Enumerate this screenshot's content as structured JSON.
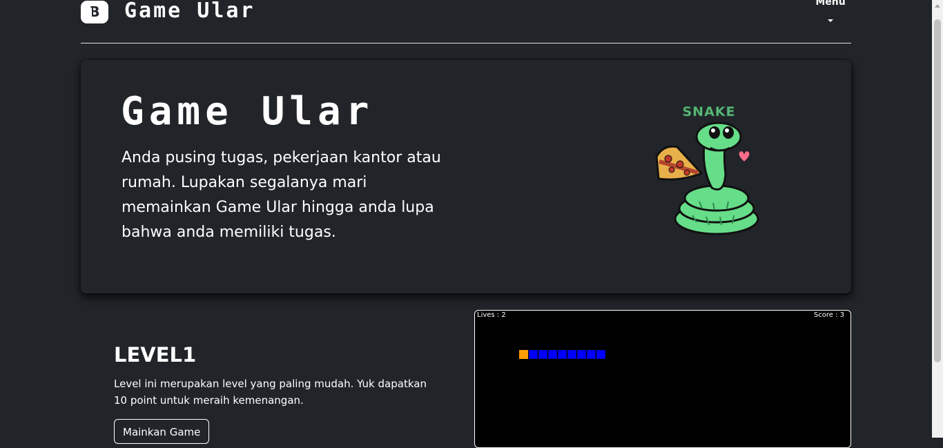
{
  "header": {
    "logo_letter": "B",
    "brand": "Game Ular",
    "menu_label": "Menu"
  },
  "hero": {
    "title": "Game Ular",
    "text": "Anda pusing tugas, pekerjaan kantor atau rumah. Lupakan segalanya mari memainkan Game Ular hingga anda lupa bahwa anda memiliki tugas.",
    "image_caption": "SNAKE"
  },
  "level": {
    "title": "LEVEL1",
    "description": "Level ini merupakan level yang paling mudah. Yuk dapatkan 10 point untuk meraih kemenangan.",
    "button_label": "Mainkan Game"
  },
  "game": {
    "lives_text": "Lives : 2",
    "score_text": "Score : 3",
    "snake": {
      "head_color": "#ff9e00",
      "body_color": "#0000ff",
      "body_segments": 8
    }
  },
  "colors": {
    "page_bg": "#212529",
    "text": "#ffffff",
    "snake_art_green": "#66dd88",
    "snake_art_label": "#5cb87a"
  }
}
